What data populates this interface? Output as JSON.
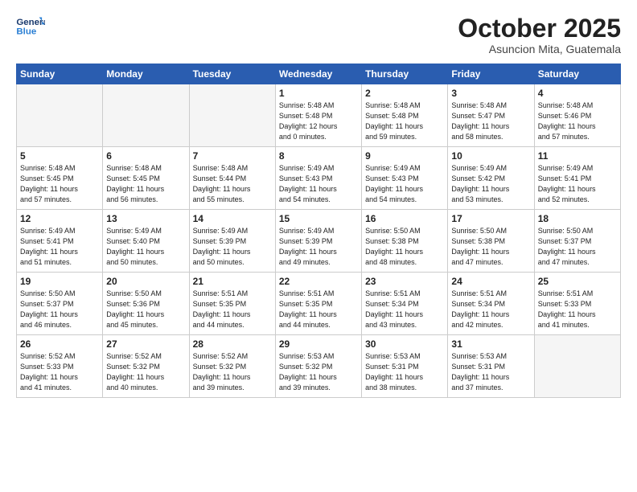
{
  "header": {
    "logo_line1": "General",
    "logo_line2": "Blue",
    "title": "October 2025",
    "subtitle": "Asuncion Mita, Guatemala"
  },
  "weekdays": [
    "Sunday",
    "Monday",
    "Tuesday",
    "Wednesday",
    "Thursday",
    "Friday",
    "Saturday"
  ],
  "weeks": [
    [
      {
        "num": "",
        "detail": ""
      },
      {
        "num": "",
        "detail": ""
      },
      {
        "num": "",
        "detail": ""
      },
      {
        "num": "1",
        "detail": "Sunrise: 5:48 AM\nSunset: 5:48 PM\nDaylight: 12 hours\nand 0 minutes."
      },
      {
        "num": "2",
        "detail": "Sunrise: 5:48 AM\nSunset: 5:48 PM\nDaylight: 11 hours\nand 59 minutes."
      },
      {
        "num": "3",
        "detail": "Sunrise: 5:48 AM\nSunset: 5:47 PM\nDaylight: 11 hours\nand 58 minutes."
      },
      {
        "num": "4",
        "detail": "Sunrise: 5:48 AM\nSunset: 5:46 PM\nDaylight: 11 hours\nand 57 minutes."
      }
    ],
    [
      {
        "num": "5",
        "detail": "Sunrise: 5:48 AM\nSunset: 5:45 PM\nDaylight: 11 hours\nand 57 minutes."
      },
      {
        "num": "6",
        "detail": "Sunrise: 5:48 AM\nSunset: 5:45 PM\nDaylight: 11 hours\nand 56 minutes."
      },
      {
        "num": "7",
        "detail": "Sunrise: 5:48 AM\nSunset: 5:44 PM\nDaylight: 11 hours\nand 55 minutes."
      },
      {
        "num": "8",
        "detail": "Sunrise: 5:49 AM\nSunset: 5:43 PM\nDaylight: 11 hours\nand 54 minutes."
      },
      {
        "num": "9",
        "detail": "Sunrise: 5:49 AM\nSunset: 5:43 PM\nDaylight: 11 hours\nand 54 minutes."
      },
      {
        "num": "10",
        "detail": "Sunrise: 5:49 AM\nSunset: 5:42 PM\nDaylight: 11 hours\nand 53 minutes."
      },
      {
        "num": "11",
        "detail": "Sunrise: 5:49 AM\nSunset: 5:41 PM\nDaylight: 11 hours\nand 52 minutes."
      }
    ],
    [
      {
        "num": "12",
        "detail": "Sunrise: 5:49 AM\nSunset: 5:41 PM\nDaylight: 11 hours\nand 51 minutes."
      },
      {
        "num": "13",
        "detail": "Sunrise: 5:49 AM\nSunset: 5:40 PM\nDaylight: 11 hours\nand 50 minutes."
      },
      {
        "num": "14",
        "detail": "Sunrise: 5:49 AM\nSunset: 5:39 PM\nDaylight: 11 hours\nand 50 minutes."
      },
      {
        "num": "15",
        "detail": "Sunrise: 5:49 AM\nSunset: 5:39 PM\nDaylight: 11 hours\nand 49 minutes."
      },
      {
        "num": "16",
        "detail": "Sunrise: 5:50 AM\nSunset: 5:38 PM\nDaylight: 11 hours\nand 48 minutes."
      },
      {
        "num": "17",
        "detail": "Sunrise: 5:50 AM\nSunset: 5:38 PM\nDaylight: 11 hours\nand 47 minutes."
      },
      {
        "num": "18",
        "detail": "Sunrise: 5:50 AM\nSunset: 5:37 PM\nDaylight: 11 hours\nand 47 minutes."
      }
    ],
    [
      {
        "num": "19",
        "detail": "Sunrise: 5:50 AM\nSunset: 5:37 PM\nDaylight: 11 hours\nand 46 minutes."
      },
      {
        "num": "20",
        "detail": "Sunrise: 5:50 AM\nSunset: 5:36 PM\nDaylight: 11 hours\nand 45 minutes."
      },
      {
        "num": "21",
        "detail": "Sunrise: 5:51 AM\nSunset: 5:35 PM\nDaylight: 11 hours\nand 44 minutes."
      },
      {
        "num": "22",
        "detail": "Sunrise: 5:51 AM\nSunset: 5:35 PM\nDaylight: 11 hours\nand 44 minutes."
      },
      {
        "num": "23",
        "detail": "Sunrise: 5:51 AM\nSunset: 5:34 PM\nDaylight: 11 hours\nand 43 minutes."
      },
      {
        "num": "24",
        "detail": "Sunrise: 5:51 AM\nSunset: 5:34 PM\nDaylight: 11 hours\nand 42 minutes."
      },
      {
        "num": "25",
        "detail": "Sunrise: 5:51 AM\nSunset: 5:33 PM\nDaylight: 11 hours\nand 41 minutes."
      }
    ],
    [
      {
        "num": "26",
        "detail": "Sunrise: 5:52 AM\nSunset: 5:33 PM\nDaylight: 11 hours\nand 41 minutes."
      },
      {
        "num": "27",
        "detail": "Sunrise: 5:52 AM\nSunset: 5:32 PM\nDaylight: 11 hours\nand 40 minutes."
      },
      {
        "num": "28",
        "detail": "Sunrise: 5:52 AM\nSunset: 5:32 PM\nDaylight: 11 hours\nand 39 minutes."
      },
      {
        "num": "29",
        "detail": "Sunrise: 5:53 AM\nSunset: 5:32 PM\nDaylight: 11 hours\nand 39 minutes."
      },
      {
        "num": "30",
        "detail": "Sunrise: 5:53 AM\nSunset: 5:31 PM\nDaylight: 11 hours\nand 38 minutes."
      },
      {
        "num": "31",
        "detail": "Sunrise: 5:53 AM\nSunset: 5:31 PM\nDaylight: 11 hours\nand 37 minutes."
      },
      {
        "num": "",
        "detail": ""
      }
    ]
  ]
}
